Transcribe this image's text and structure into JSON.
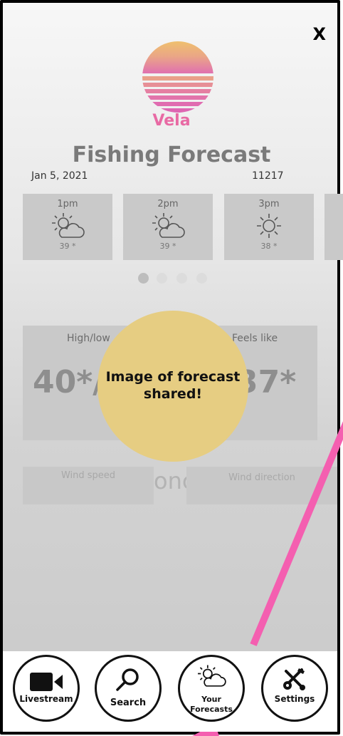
{
  "close_label": "X",
  "app": {
    "brand": "Vela",
    "title": "Fishing Forecast"
  },
  "meta": {
    "date": "Jan 5, 2021",
    "zip": "11217"
  },
  "hourly": [
    {
      "time": "1pm",
      "icon": "partly-cloudy-icon",
      "temp": "39 *"
    },
    {
      "time": "2pm",
      "icon": "partly-cloudy-icon",
      "temp": "39 *"
    },
    {
      "time": "3pm",
      "icon": "sun-icon",
      "temp": "38 *"
    }
  ],
  "pager": {
    "count": 4,
    "active_index": 0
  },
  "stats": {
    "high_low_label": "High/low",
    "high_low_value": "40*/",
    "feels_like_label": "Feels like",
    "feels_like_value": "37*"
  },
  "wind": {
    "speed_label": "Wind speed",
    "direction_label": "Wind direction",
    "background_text": "onc"
  },
  "toast": {
    "message": "Image of forecast shared!"
  },
  "nav": {
    "livestream": "Livestream",
    "search": "Search",
    "forecasts_line1": "Your",
    "forecasts_line2": "Forecasts",
    "settings": "Settings"
  },
  "colors": {
    "brand_pink": "#e86aa4",
    "toast_yellow": "#e6cd82",
    "annotation_pink": "#f45fb0"
  }
}
